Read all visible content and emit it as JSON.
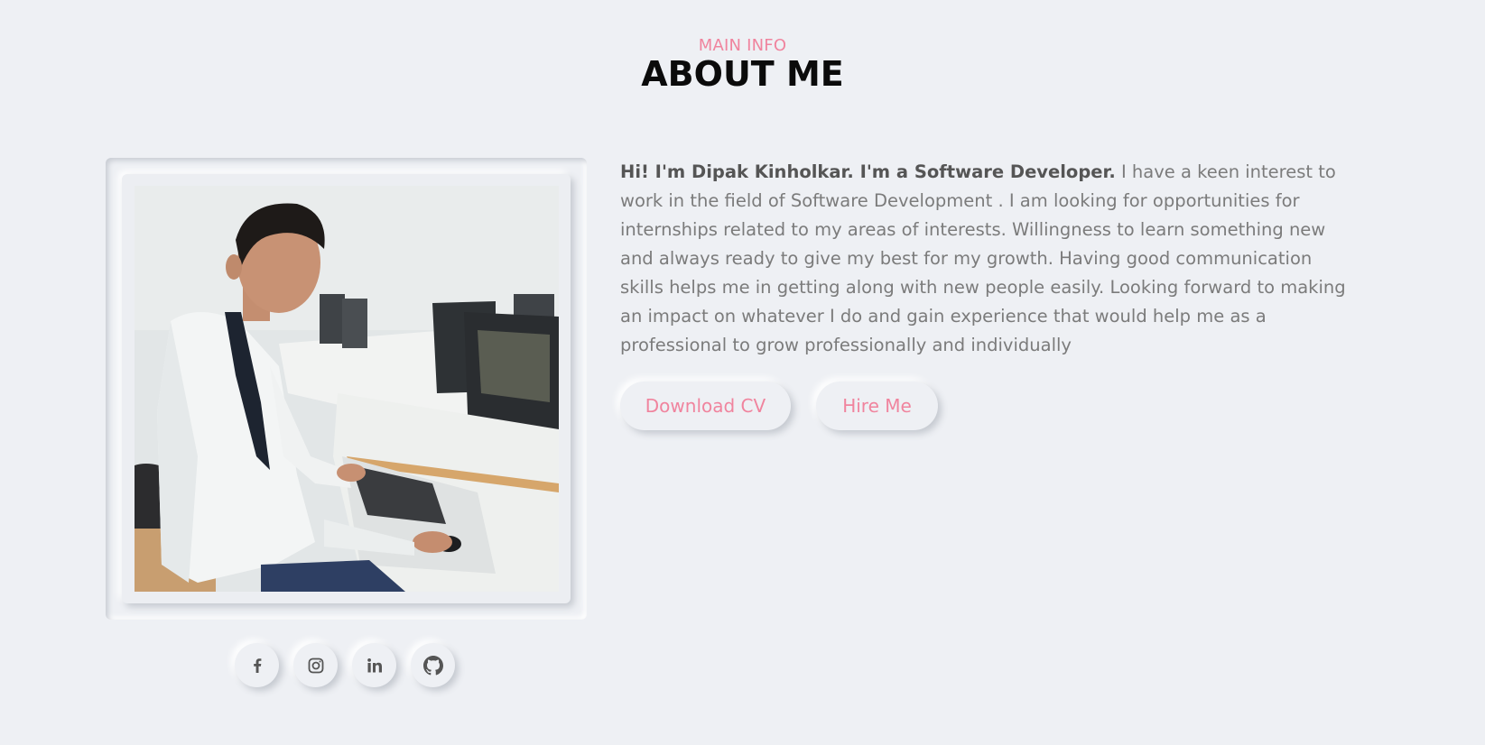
{
  "header": {
    "kicker": "MAIN INFO",
    "title": "ABOUT ME"
  },
  "profile": {
    "photo_alt": "Photo of developer seated at a computer desk"
  },
  "bio": {
    "intro": "Hi! I'm Dipak Kinholkar. I'm a Software Developer.",
    "body": " I have a keen interest to work in the field of Software Development . I am looking for opportunities for internships related to my areas of interests. Willingness to learn something new and always ready to give my best for my growth. Having good communication skills helps me in getting along with new people easily. Looking forward to making an impact on whatever I do and gain experience that would help me as a professional to grow professionally and individually"
  },
  "actions": {
    "download_cv": "Download CV",
    "hire_me": "Hire Me"
  },
  "socials": [
    {
      "icon": "facebook-icon",
      "label": "f"
    },
    {
      "icon": "instagram-icon",
      "label": ""
    },
    {
      "icon": "linkedin-icon",
      "label": "in"
    },
    {
      "icon": "github-icon",
      "label": ""
    }
  ],
  "colors": {
    "accent": "#f0849e",
    "background": "#eef0f4",
    "text": "#7b7b7b",
    "title": "#0b0b0b"
  }
}
